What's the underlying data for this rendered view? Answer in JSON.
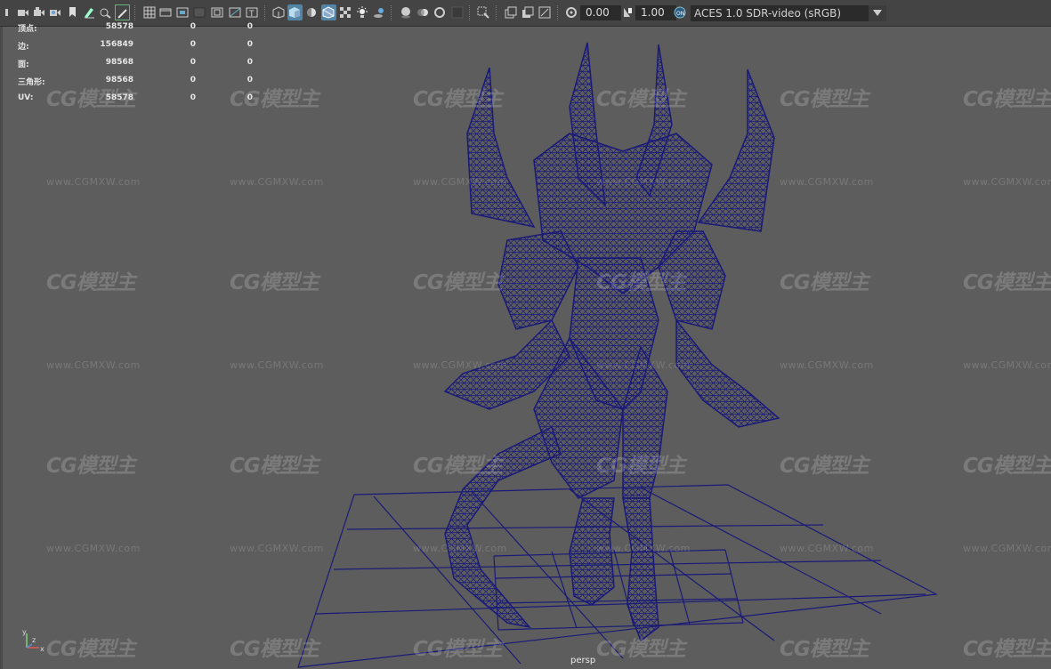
{
  "toolbar": {
    "exposure_value": "0.00",
    "gamma_value": "1.00",
    "color_space": "ACES 1.0 SDR-video (sRGB)"
  },
  "hud": {
    "rows": [
      {
        "label": "顶点:",
        "total": "58578",
        "selected": "0",
        "component": "0"
      },
      {
        "label": "边:",
        "total": "156849",
        "selected": "0",
        "component": "0"
      },
      {
        "label": "面:",
        "total": "98568",
        "selected": "0",
        "component": "0"
      },
      {
        "label": "三角形:",
        "total": "98568",
        "selected": "0",
        "component": "0"
      },
      {
        "label": "UV:",
        "total": "58578",
        "selected": "0",
        "component": "0"
      }
    ]
  },
  "viewport": {
    "camera_label": "persp",
    "watermark_logo": "CG模型主",
    "watermark_url": "www.CGMXW.com"
  },
  "axis": {
    "x": "x",
    "y": "y",
    "z": "z"
  },
  "colors": {
    "viewport_bg": "#5d5d5d",
    "wireframe": "#1a1a78",
    "toolbar_bg": "#444444",
    "active_button": "#5285a6"
  }
}
